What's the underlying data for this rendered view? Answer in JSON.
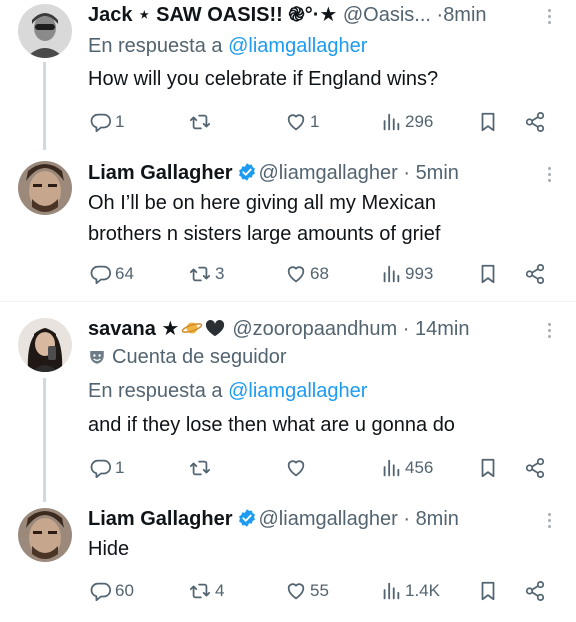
{
  "colors": {
    "link": "#1d9bf0",
    "muted": "#536471",
    "text": "#0f1419",
    "verified": "#1d9bf0",
    "divider": "#eff3f4"
  },
  "tweets": [
    {
      "name": "Jack ⋆ SAW OASIS!! ֎°·★",
      "handle": "@Oasis...",
      "time": "8min",
      "reply_to_prefix": "En respuesta a",
      "reply_to_handle": "@liamgallagher",
      "text": [
        "How will you celebrate if England wins?"
      ],
      "replies": "1",
      "reposts": "",
      "likes": "1",
      "views": "296"
    },
    {
      "name": "Liam Gallagher",
      "verified": true,
      "handle": "@liamgallagher",
      "time": "5min",
      "text": [
        "Oh I’ll be on here giving all my Mexican",
        "brothers n sisters large amounts of grief"
      ],
      "replies": "64",
      "reposts": "3",
      "likes": "68",
      "views": "993"
    },
    {
      "name": "savana ★",
      "handle": "@zooropaandhum",
      "time": "14min",
      "label": "Cuenta de seguidor",
      "reply_to_prefix": "En respuesta a",
      "reply_to_handle": "@liamgallagher",
      "text": [
        "and if they lose then what are u gonna do"
      ],
      "replies": "1",
      "reposts": "",
      "likes": "",
      "views": "456"
    },
    {
      "name": "Liam Gallagher",
      "verified": true,
      "handle": "@liamgallagher",
      "time": "8min",
      "text": [
        "Hide"
      ],
      "replies": "60",
      "reposts": "4",
      "likes": "55",
      "views": "1.4K"
    }
  ],
  "sep": "·",
  "icons": [
    "reply-icon",
    "repost-icon",
    "like-icon",
    "views-icon",
    "bookmark-icon",
    "share-icon",
    "verified-badge-icon",
    "more-options-icon",
    "follower-mask-icon",
    "planet-emoji-icon",
    "black-heart-emoji-icon"
  ]
}
